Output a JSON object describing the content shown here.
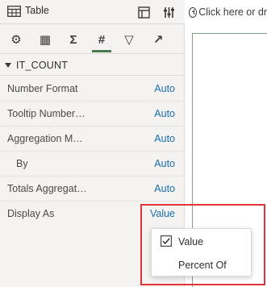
{
  "header": {
    "title": "Table",
    "icons": {
      "table": "table-icon",
      "properties": "properties-icon",
      "grammar": "grammar-sliders-icon"
    }
  },
  "tabs": [
    {
      "name": "general",
      "icon": "gear-icon",
      "glyph": "⚙"
    },
    {
      "name": "data",
      "icon": "grid-icon",
      "glyph": "▦"
    },
    {
      "name": "aggregation",
      "icon": "sigma-icon",
      "glyph": "Σ"
    },
    {
      "name": "number",
      "icon": "hash-icon",
      "glyph": "#",
      "active": true
    },
    {
      "name": "filter",
      "icon": "filter-icon",
      "glyph": "▽"
    },
    {
      "name": "analytics",
      "icon": "trend-icon",
      "glyph": "↗"
    }
  ],
  "section": {
    "label": "IT_COUNT"
  },
  "rows": [
    {
      "key": "Number Format",
      "value": "Auto"
    },
    {
      "key": "Tooltip Number…",
      "value": "Auto"
    },
    {
      "key": "Aggregation M…",
      "value": "Auto"
    },
    {
      "key": "By",
      "value": "Auto"
    },
    {
      "key": "Totals Aggregat…",
      "value": "Auto"
    },
    {
      "key": "Display As",
      "value": "Value"
    }
  ],
  "canvas": {
    "hint": "Click here or dr"
  },
  "dropdown": {
    "options": [
      {
        "label": "Value",
        "checked": true
      },
      {
        "label": "Percent Of",
        "checked": false
      }
    ]
  },
  "colors": {
    "accent": "#4d7a4d",
    "link": "#1b6ea8",
    "highlight": "#e0363a"
  }
}
